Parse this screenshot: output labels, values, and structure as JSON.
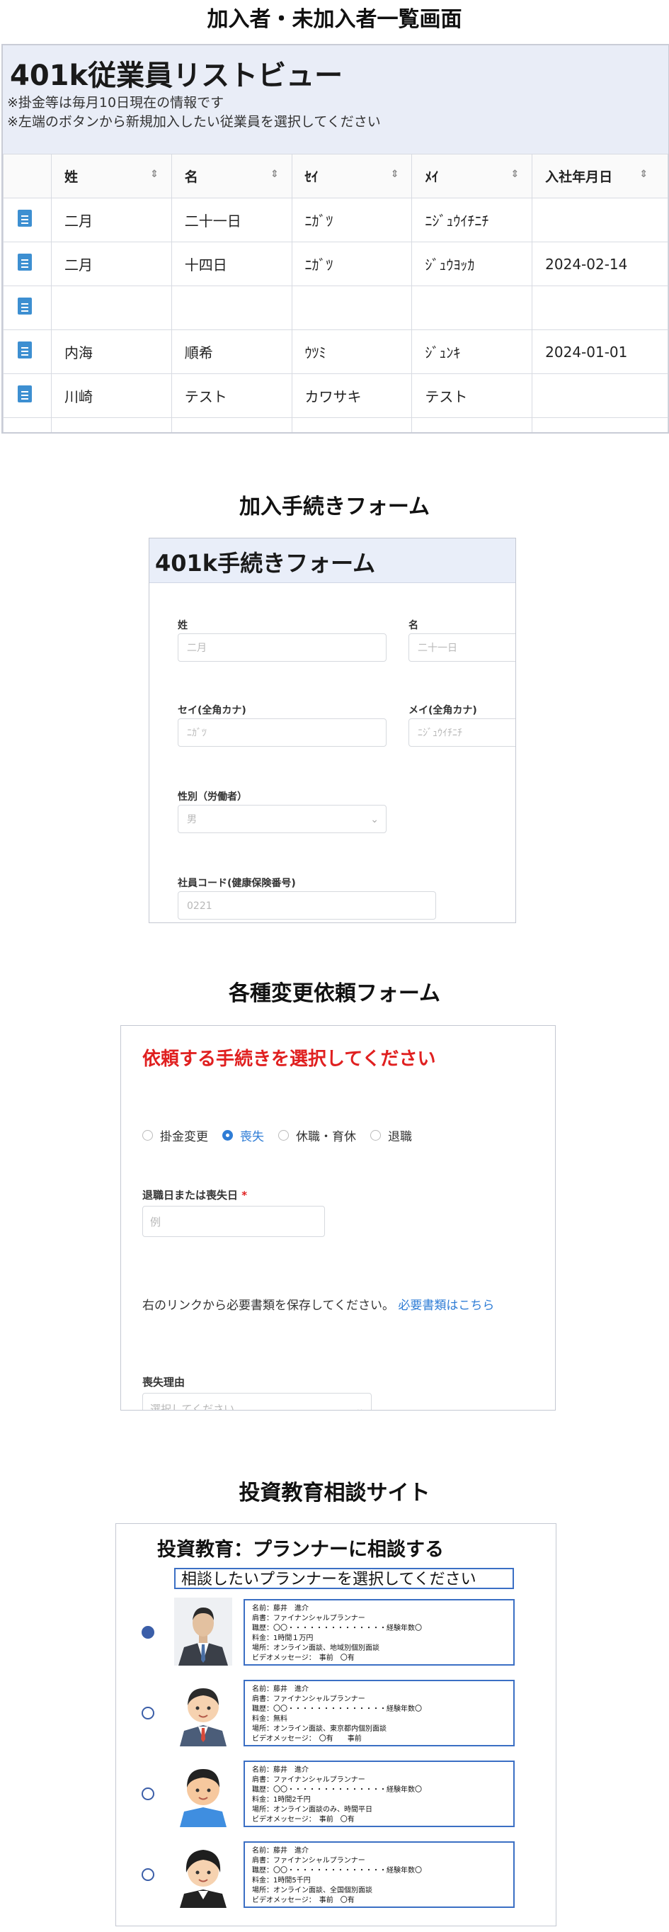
{
  "sections": {
    "s1": "加入者・未加入者一覧画面",
    "s2": "加入手続きフォーム",
    "s3": "各種変更依頼フォーム",
    "s4": "投資教育相談サイト"
  },
  "list_view": {
    "title": "401k従業員リストビュー",
    "note1": "※掛金等は毎月10日現在の情報です",
    "note2": "※左端のボタンから新規加入したい従業員を選択してください",
    "columns": [
      "姓",
      "名",
      "ｾｲ",
      "ﾒｲ",
      "入社年月日"
    ],
    "rows": [
      [
        "二月",
        "二十一日",
        "ﾆｶﾞﾂ",
        "ﾆｼﾞｭｳｲﾁﾆﾁ",
        ""
      ],
      [
        "二月",
        "十四日",
        "ﾆｶﾞﾂ",
        "ｼﾞｭｳﾖｯｶ",
        "2024-02-14"
      ],
      [
        "",
        "",
        "",
        "",
        ""
      ],
      [
        "内海",
        "順希",
        "ｳﾂﾐ",
        "ｼﾞｭﾝｷ",
        "2024-01-01"
      ],
      [
        "川崎",
        "テスト",
        "カワサキ",
        "テスト",
        ""
      ]
    ]
  },
  "enroll_form": {
    "title": "401k手続きフォーム",
    "last_name_label": "姓",
    "last_name_value": "二月",
    "first_name_label": "名",
    "first_name_value": "二十一日",
    "last_kana_label": "セイ(全角カナ)",
    "last_kana_value": "ﾆｶﾞﾂ",
    "first_kana_label": "メイ(全角カナ)",
    "first_kana_value": "ﾆｼﾞｭｳｲﾁﾆﾁ",
    "gender_label": "性別（労働者）",
    "gender_value": "男",
    "code_label": "社員コード(健康保険番号)",
    "code_value": "0221"
  },
  "change_form": {
    "title": "依頼する手続きを選択してください",
    "options": [
      "掛金変更",
      "喪失",
      "休職・育休",
      "退職"
    ],
    "selected_option": "喪失",
    "date_label": "退職日または喪失日",
    "required_mark": "*",
    "date_placeholder": "例",
    "link_text": "右のリンクから必要書類を保存してください。",
    "link_label": "必要書類はこちら",
    "reason_label": "喪失理由",
    "reason_placeholder": "選択してください"
  },
  "consult_site": {
    "title": "投資教育：プランナーに相談する",
    "prompt": "相談したいプランナーを選択してください",
    "planners": [
      {
        "selected": true,
        "lines": [
          "名前：藤井　進介",
          "肩書：ファイナンシャルプランナー",
          "職歴：〇〇・・・・・・・・・・・・・・経験年数〇",
          "料金：1時間１万円",
          "場所：オンライン面談、地域別個別面談",
          "ビデオメッセージ：　事前　〇有"
        ]
      },
      {
        "selected": false,
        "lines": [
          "名前：藤井　進介",
          "肩書：ファイナンシャルプランナー",
          "職歴：〇〇・・・・・・・・・・・・・・経験年数〇",
          "料金：無料",
          "場所：オンライン面談、東京都内個別面談",
          "ビデオメッセージ：　〇有　　事前"
        ]
      },
      {
        "selected": false,
        "lines": [
          "名前：藤井　進介",
          "肩書：ファイナンシャルプランナー",
          "職歴：〇〇・・・・・・・・・・・・・・経験年数〇",
          "料金：1時間2千円",
          "場所：オンライン面談のみ、時間平日",
          "ビデオメッセージ：　事前　〇有"
        ]
      },
      {
        "selected": false,
        "lines": [
          "名前：藤井　進介",
          "肩書：ファイナンシャルプランナー",
          "職歴：〇〇・・・・・・・・・・・・・・経験年数〇",
          "料金：1時間5千円",
          "場所：オンライン面談、全国個別面談",
          "ビデオメッセージ：　事前　〇有"
        ]
      }
    ]
  }
}
